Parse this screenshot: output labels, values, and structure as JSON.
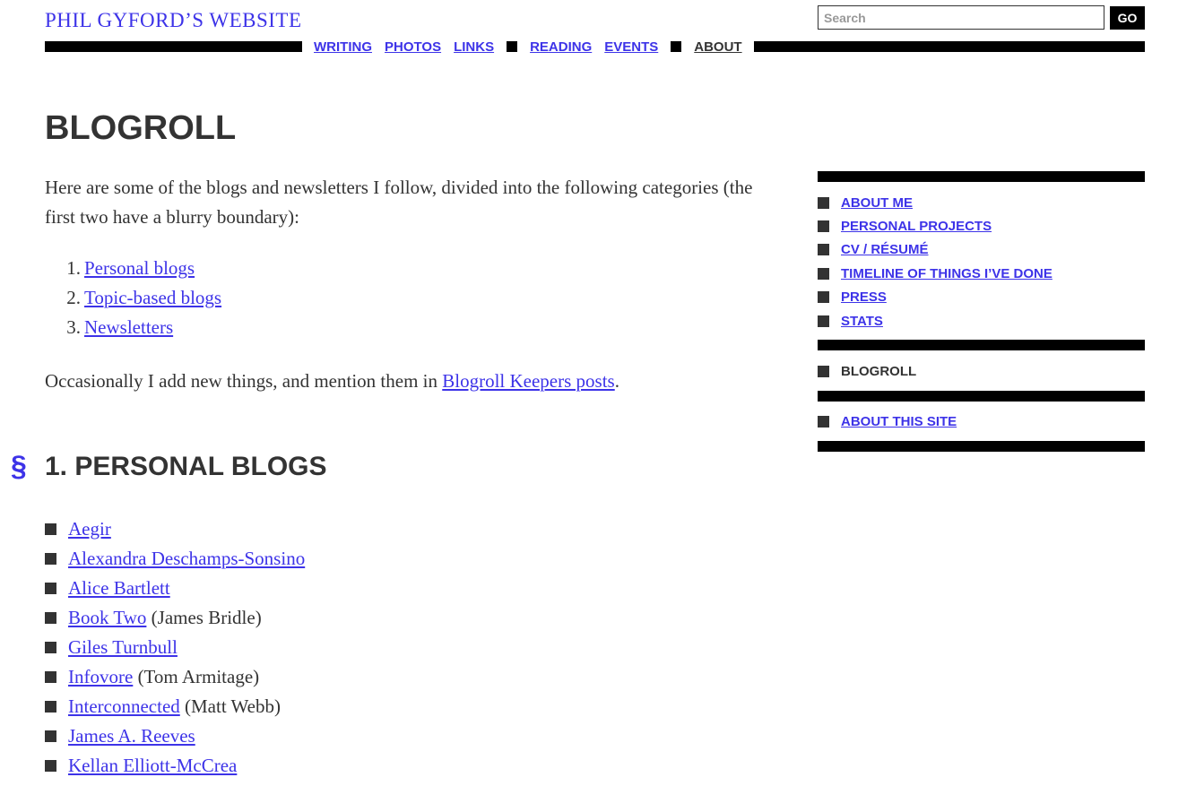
{
  "header": {
    "site_title": "PHIL GYFORD’S WEBSITE",
    "search_placeholder": "Search",
    "search_value": "",
    "go_label": "GO",
    "nav": {
      "group1": [
        "WRITING",
        "PHOTOS",
        "LINKS"
      ],
      "group2": [
        "READING",
        "EVENTS"
      ],
      "group3": [
        "ABOUT"
      ],
      "current": "ABOUT"
    }
  },
  "main": {
    "title": "BLOGROLL",
    "intro": "Here are some of the blogs and newsletters I follow, divided into the following categories (the first two have a blurry boundary):",
    "categories": [
      {
        "num": "1.",
        "label": "Personal blogs"
      },
      {
        "num": "2.",
        "label": "Topic-based blogs"
      },
      {
        "num": "3.",
        "label": "Newsletters"
      }
    ],
    "occasional_before": "Occasionally I add new things, and mention them in ",
    "occasional_link": "Blogroll Keepers posts",
    "occasional_after": ".",
    "section_mark": "§",
    "section_heading": "1. PERSONAL BLOGS",
    "blogs": [
      {
        "name": "Aegir",
        "note": ""
      },
      {
        "name": "Alexandra Deschamps-Sonsino",
        "note": ""
      },
      {
        "name": "Alice Bartlett",
        "note": ""
      },
      {
        "name": "Book Two",
        "note": " (James Bridle)"
      },
      {
        "name": "Giles Turnbull",
        "note": ""
      },
      {
        "name": "Infovore",
        "note": " (Tom Armitage)"
      },
      {
        "name": "Interconnected",
        "note": " (Matt Webb)"
      },
      {
        "name": "James A. Reeves",
        "note": ""
      },
      {
        "name": "Kellan Elliott-McCrea",
        "note": ""
      }
    ]
  },
  "sidebar": {
    "group1": [
      "ABOUT ME",
      "PERSONAL PROJECTS",
      "CV / RÉSUMÉ",
      "TIMELINE OF THINGS I’VE DONE",
      "PRESS",
      "STATS"
    ],
    "group2_current": "BLOGROLL",
    "group3": [
      "ABOUT THIS SITE"
    ]
  }
}
